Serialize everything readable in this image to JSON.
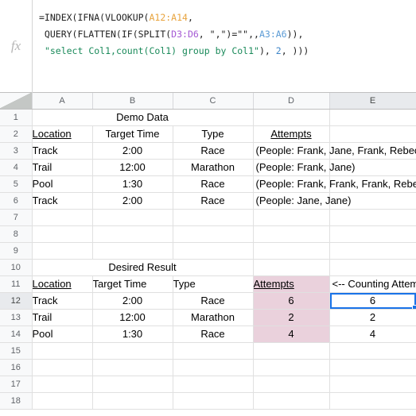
{
  "formula_bar": {
    "fx_icon": "fx-icon",
    "formula_lines": [
      "=INDEX(IFNA(VLOOKUP(A12:A14,",
      " QUERY(FLATTEN(IF(SPLIT(D3:D6, \",\")=\"\",,A3:A6)),",
      " \"select Col1,count(Col1) group by Col1\"), 2, )))"
    ],
    "tokens": {
      "l1_a": "=INDEX(IFNA(VLOOKUP(",
      "l1_ref": "A12:A14",
      "l1_b": ",",
      "l2_a": " QUERY(FLATTEN(IF(SPLIT(",
      "l2_ref1": "D3:D6",
      "l2_b": ", \",\")=\"\",,",
      "l2_ref2": "A3:A6",
      "l2_c": ")),",
      "l3_a": " ",
      "l3_str": "\"select Col1,count(Col1) group by Col1\"",
      "l3_b": "), ",
      "l3_num": "2",
      "l3_c": ", )))"
    }
  },
  "grid": {
    "column_headers": [
      "A",
      "B",
      "C",
      "D",
      "E"
    ],
    "selected_column": "E",
    "selected_row": "12",
    "selected_cell": "E12",
    "row_numbers": [
      "1",
      "2",
      "3",
      "4",
      "5",
      "6",
      "7",
      "8",
      "9",
      "10",
      "11",
      "12",
      "13",
      "14",
      "15",
      "16",
      "17",
      "18"
    ],
    "rows": {
      "r1": {
        "merged_title": "Demo Data"
      },
      "r2": {
        "a": "Location",
        "b": "Target Time",
        "c": "Type",
        "d": "Attempts",
        "e": ""
      },
      "r3": {
        "a": "Track",
        "b": "2:00",
        "c": "Race",
        "d": "(People: Frank, Jane, Frank, Rebecca)",
        "e": ""
      },
      "r4": {
        "a": "Trail",
        "b": "12:00",
        "c": "Marathon",
        "d": "(People: Frank, Jane)",
        "e": ""
      },
      "r5": {
        "a": "Pool",
        "b": "1:30",
        "c": "Race",
        "d": "(People: Frank, Frank, Frank, Rebecca)",
        "e": ""
      },
      "r6": {
        "a": "Track",
        "b": "2:00",
        "c": "Race",
        "d": "(People: Jane, Jane)",
        "e": ""
      },
      "r7": {
        "a": "",
        "b": "",
        "c": "",
        "d": "",
        "e": ""
      },
      "r8": {
        "a": "",
        "b": "",
        "c": "",
        "d": "",
        "e": ""
      },
      "r9": {
        "a": "",
        "b": "",
        "c": "",
        "d": "",
        "e": ""
      },
      "r10": {
        "merged_title": "Desired Result"
      },
      "r11": {
        "a": "Location",
        "b": "Target Time",
        "c": "Type",
        "d": "Attempts",
        "e": "<-- Counting Attempts"
      },
      "r12": {
        "a": "Track",
        "b": "2:00",
        "c": "Race",
        "d": "6",
        "e": "6"
      },
      "r13": {
        "a": "Trail",
        "b": "12:00",
        "c": "Marathon",
        "d": "2",
        "e": "2"
      },
      "r14": {
        "a": "Pool",
        "b": "1:30",
        "c": "Race",
        "d": "4",
        "e": "4"
      },
      "r15": {
        "a": "",
        "b": "",
        "c": "",
        "d": "",
        "e": ""
      },
      "r16": {
        "a": "",
        "b": "",
        "c": "",
        "d": "",
        "e": ""
      },
      "r17": {
        "a": "",
        "b": "",
        "c": "",
        "d": "",
        "e": ""
      },
      "r18": {
        "a": "",
        "b": "",
        "c": "",
        "d": "",
        "e": ""
      }
    }
  },
  "colors": {
    "selection_blue": "#1a73e8",
    "highlight_pink": "#ead1dc",
    "header_gray": "#f8f9fa",
    "header_selected_gray": "#e8eaed",
    "gridline": "#e0e0e0",
    "formula_string_green": "#1a8a5a",
    "formula_ref_orange": "#e8a33d",
    "formula_ref_purple": "#a55ad4",
    "formula_ref_blue": "#5b9bd5"
  }
}
